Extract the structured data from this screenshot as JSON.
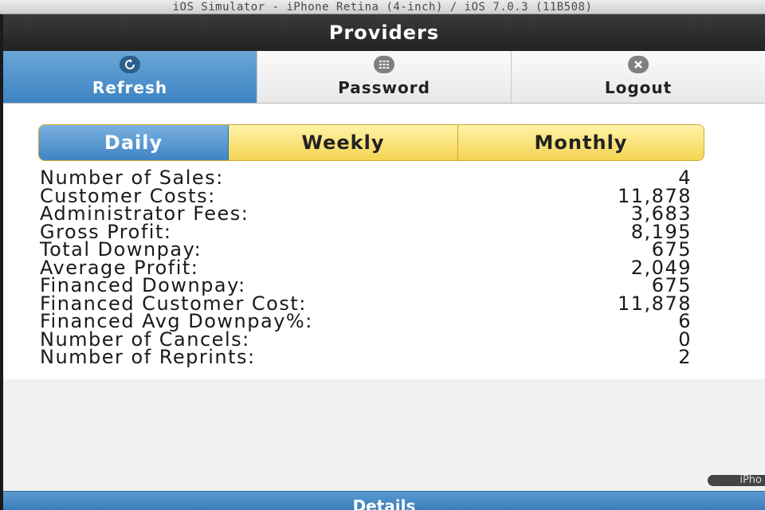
{
  "window_title": "iOS Simulator - iPhone Retina (4-inch) / iOS 7.0.3 (11B508)",
  "header": {
    "title": "Providers"
  },
  "navbar": {
    "items": [
      {
        "label": "Refresh",
        "icon": "refresh-icon",
        "active": true
      },
      {
        "label": "Password",
        "icon": "keypad-icon",
        "active": false
      },
      {
        "label": "Logout",
        "icon": "close-icon",
        "active": false
      }
    ]
  },
  "period_tabs": {
    "items": [
      {
        "label": "Daily",
        "active": true
      },
      {
        "label": "Weekly",
        "active": false
      },
      {
        "label": "Monthly",
        "active": false
      }
    ]
  },
  "stats": [
    {
      "label": "Number of Sales:",
      "value": "4"
    },
    {
      "label": "Customer Costs:",
      "value": "11,878"
    },
    {
      "label": "Administrator Fees:",
      "value": "3,683"
    },
    {
      "label": "Gross Profit:",
      "value": "8,195"
    },
    {
      "label": "Total Downpay:",
      "value": "675"
    },
    {
      "label": "Average Profit:",
      "value": "2,049"
    },
    {
      "label": "Financed Downpay:",
      "value": "675"
    },
    {
      "label": "Financed Customer Cost:",
      "value": "11,878"
    },
    {
      "label": "Financed Avg Downpay%:",
      "value": "6"
    },
    {
      "label": "Number of Cancels:",
      "value": "0"
    },
    {
      "label": "Number of Reprints:",
      "value": "2"
    }
  ],
  "footer": {
    "label": "Details"
  },
  "sim_badge": {
    "label": "iPho"
  },
  "colors": {
    "active_blue": "#3e84c2",
    "tab_yellow": "#f5d452",
    "header_dark": "#232323"
  }
}
